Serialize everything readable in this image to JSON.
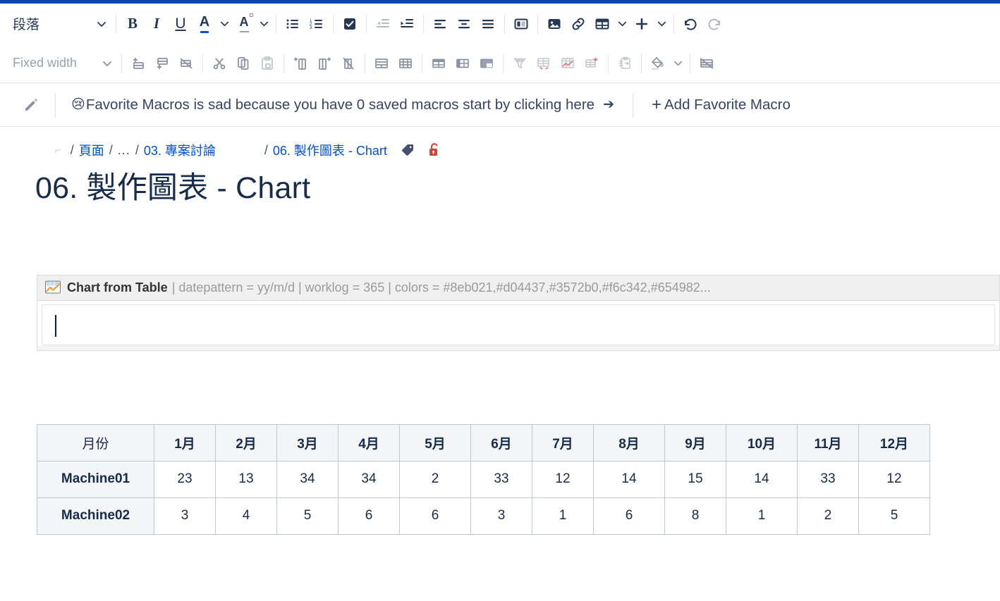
{
  "window": {
    "accent_color": "#0747a6",
    "link_color": "#0052cc"
  },
  "toolbar": {
    "row1": {
      "style_select_value": "段落",
      "bold_label": "B",
      "italic_label": "I",
      "underline_label": "U",
      "text_color_label": "A",
      "highlight_label": "A"
    },
    "row2": {
      "width_select_value": "Fixed width"
    }
  },
  "favorites": {
    "emoji": "😢",
    "message": "Favorite Macros is sad because you have 0 saved macros start by clicking here",
    "arrow": "➔",
    "plus": "+",
    "add_label": "Add Favorite Macro"
  },
  "breadcrumb": {
    "sep": "/",
    "ellipsis": "...",
    "items": [
      {
        "label": "頁面",
        "link": true
      },
      {
        "label": "...",
        "link": false
      },
      {
        "label": "03. 專案討論",
        "link": true
      },
      {
        "label": "06. 製作圖表 - Chart",
        "link": true
      }
    ]
  },
  "page": {
    "title": "06. 製作圖表 - Chart"
  },
  "macro": {
    "icon": "chart-from-table-icon",
    "name": "Chart from Table",
    "params": "| datepattern = yy/m/d | worklog = 365 | colors = #8eb021,#d04437,#3572b0,#f6c342,#654982...",
    "param_list": [
      {
        "key": "datepattern",
        "value": "yy/m/d"
      },
      {
        "key": "worklog",
        "value": "365"
      },
      {
        "key": "colors",
        "value": "#8eb021,#d04437,#3572b0,#f6c342,#654982..."
      }
    ],
    "body_text": ""
  },
  "chart_data": {
    "type": "table",
    "title": "06. 製作圖表 - Chart",
    "xlabel": "月份",
    "ylabel": "",
    "categories": [
      "1月",
      "2月",
      "3月",
      "4月",
      "5月",
      "6月",
      "7月",
      "8月",
      "9月",
      "10月",
      "11月",
      "12月"
    ],
    "series": [
      {
        "name": "Machine01",
        "values": [
          23,
          13,
          34,
          34,
          2,
          33,
          12,
          14,
          15,
          14,
          33,
          12
        ]
      },
      {
        "name": "Machine02",
        "values": [
          3,
          4,
          5,
          6,
          6,
          3,
          1,
          6,
          8,
          1,
          2,
          5
        ]
      }
    ],
    "colors": [
      "#8eb021",
      "#d04437",
      "#3572b0",
      "#f6c342",
      "#654982"
    ],
    "legend": [
      "Machine01",
      "Machine02"
    ],
    "grid": true
  },
  "table": {
    "corner_header": "月份",
    "headers": [
      "月份",
      "1月",
      "2月",
      "3月",
      "4月",
      "5月",
      "6月",
      "7月",
      "8月",
      "9月",
      "10月",
      "11月",
      "12月"
    ],
    "rows": [
      {
        "label": "Machine01",
        "cells": [
          "23",
          "13",
          "34",
          "34",
          "2",
          "33",
          "12",
          "14",
          "15",
          "14",
          "33",
          "12"
        ]
      },
      {
        "label": "Machine02",
        "cells": [
          "3",
          "4",
          "5",
          "6",
          "6",
          "3",
          "1",
          "6",
          "8",
          "1",
          "2",
          "5"
        ]
      }
    ]
  }
}
